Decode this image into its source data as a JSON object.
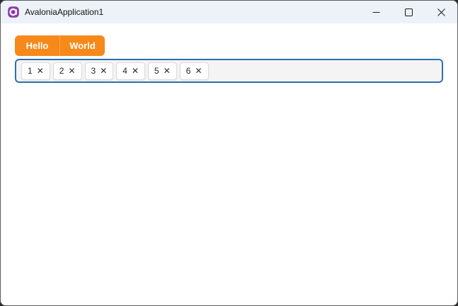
{
  "window": {
    "title": "AvaloniaApplication1"
  },
  "titlebar": {
    "icons": {
      "app": "avalonia-logo",
      "minimize": "minimize-icon",
      "maximize": "maximize-icon",
      "close": "close-icon"
    }
  },
  "tabstrip": {
    "tabs": [
      {
        "label": "Hello"
      },
      {
        "label": "World"
      }
    ]
  },
  "chipbox": {
    "remove_glyph": "✕",
    "chips": [
      {
        "value": "1"
      },
      {
        "value": "2"
      },
      {
        "value": "3"
      },
      {
        "value": "4"
      },
      {
        "value": "5"
      },
      {
        "value": "6"
      }
    ]
  },
  "colors": {
    "accent_orange": "#F6891A",
    "tab_divider": "#F9A851",
    "chipbox_border": "#2D70AF",
    "chipbox_bg": "#F4F4F4",
    "titlebar_bg": "#EDF2F8",
    "window_border": "#5C5C5C",
    "desktop_bg": "#2B2B2B",
    "avalonia_purple": "#8B3DAE"
  }
}
